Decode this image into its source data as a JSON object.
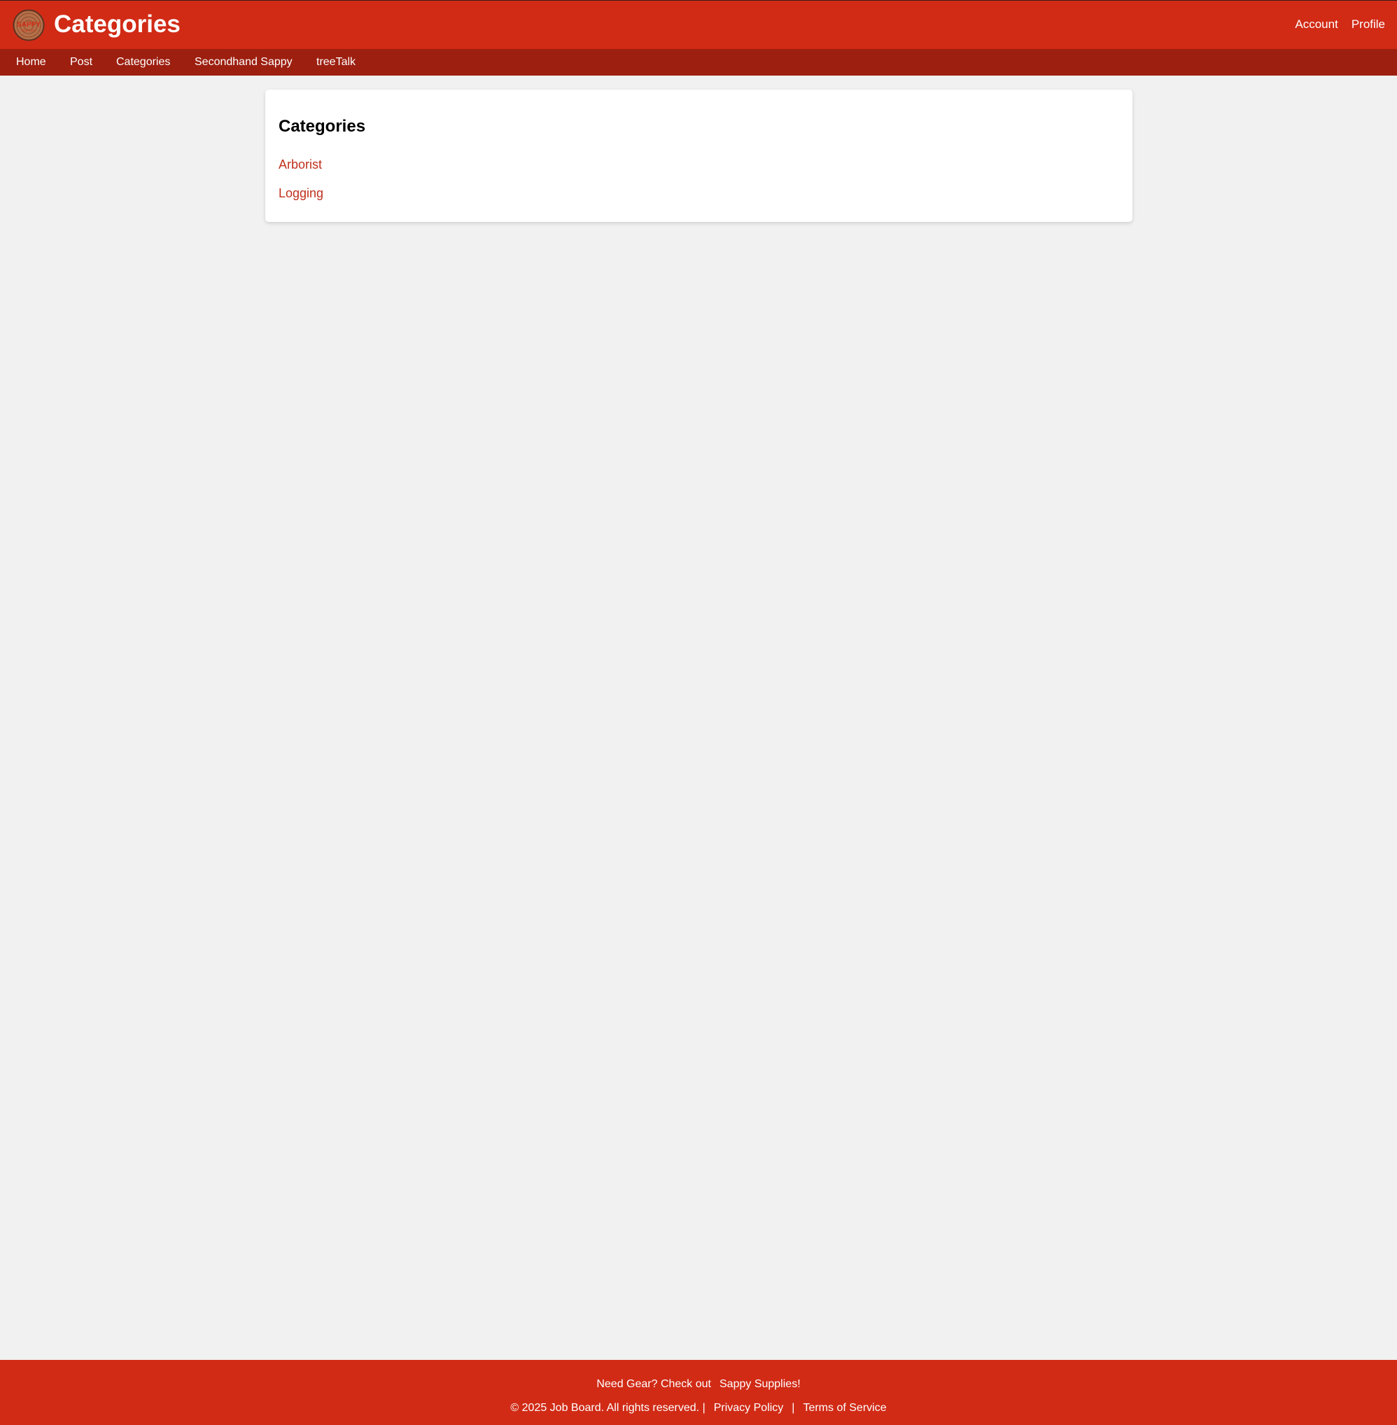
{
  "colors": {
    "header_bg": "#d12b16",
    "nav_bg": "#9d1f10",
    "page_bg": "#f1f1f1",
    "link": "#c0301c"
  },
  "header": {
    "logo_text": "SAPPY",
    "title": "Categories",
    "links": [
      "Account",
      "Profile"
    ]
  },
  "nav": {
    "items": [
      "Home",
      "Post",
      "Categories",
      "Secondhand Sappy",
      "treeTalk"
    ]
  },
  "main": {
    "card_title": "Categories",
    "categories": [
      "Arborist",
      "Logging"
    ]
  },
  "footer": {
    "gear_prefix": "Need Gear? Check out",
    "gear_link": "Sappy Supplies!",
    "copyright": "© 2025 Job Board. All rights reserved. |",
    "privacy": "Privacy Policy",
    "separator": "|",
    "terms": "Terms of Service"
  }
}
